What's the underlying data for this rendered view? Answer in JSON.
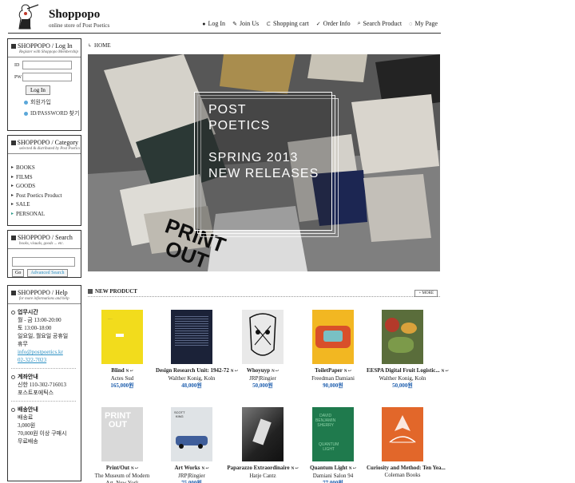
{
  "header": {
    "brand": "Shoppopo",
    "tagline": "online store of Post Poetics",
    "nav": [
      {
        "label": "Log In",
        "icon": "dot-icon",
        "glyph": "●"
      },
      {
        "label": "Join Us",
        "icon": "pen-icon",
        "glyph": "✎"
      },
      {
        "label": "Shopping cart",
        "icon": "cart-icon",
        "glyph": "⊂"
      },
      {
        "label": "Order Info",
        "icon": "check-icon",
        "glyph": "✓"
      },
      {
        "label": "Search Product",
        "icon": "search-icon",
        "glyph": "⌕"
      },
      {
        "label": "My Page",
        "icon": "circle-icon",
        "glyph": "◌"
      }
    ]
  },
  "login": {
    "title": "SHOPPOPO / Log In",
    "subtitle": "Register with Shoppopo Membership",
    "id_label": "ID",
    "pw_label": "PW",
    "button": "Log In",
    "links": [
      "회원가입",
      "ID/PASSWORD 찾기"
    ]
  },
  "category": {
    "title": "SHOPPOPO / Category",
    "subtitle": "selected & distributed by Post Poetics",
    "items": [
      "BOOKS",
      "FILMS",
      "GOODS",
      "Post Poetics Product",
      "SALE",
      "PERSONAL"
    ]
  },
  "search": {
    "title": "SHOPPOPO / Search",
    "subtitle": "books, visuals, goods ... etc.",
    "go": "Go",
    "advanced": "Advanced Search"
  },
  "help": {
    "title": "SHOPPOPO / Help",
    "subtitle": "for more informations and help",
    "sections": [
      {
        "head": "업무시간",
        "lines": [
          "월 - 금 13:00-20:00",
          "토 13:00-18:00",
          "일요일, 월요일 공휴일",
          "휴무"
        ],
        "extra": [
          "info@postpoetics.kr",
          "02-322-7023"
        ]
      },
      {
        "head": "계좌안내",
        "lines": [
          "신한 110-302-716013",
          "포스트포에틱스"
        ],
        "extra": []
      },
      {
        "head": "배송안내",
        "lines": [
          "배송료",
          "3,000원",
          "70,000원 이상 구매시",
          "무료배송"
        ],
        "extra": []
      }
    ]
  },
  "main": {
    "breadcrumb": "HOME",
    "hero": {
      "line1": "POST",
      "line2": "POETICS",
      "line3": "SPRING 2013",
      "line4": "NEW RELEASES"
    },
    "new_product_title": "NEW PRODUCT",
    "more": "+ MORE",
    "products": [
      {
        "name": "Blind",
        "badge": "N ↩",
        "author": "Actes Sud",
        "price": "165,000원",
        "cover": "#f2dc1c"
      },
      {
        "name": "Design Research Unit: 1942-72",
        "badge": "N ↩",
        "author": "Walther Konig, Koln",
        "price": "48,000원",
        "cover": "#1b2238"
      },
      {
        "name": "Whoyuyp",
        "badge": "N ↩",
        "author": "JRP|Ringier",
        "price": "50,000원",
        "cover": "#e9e9e9"
      },
      {
        "name": "ToiletPaper",
        "badge": "N ↩",
        "author": "Freedman Damiani",
        "price": "90,000원",
        "cover": "#f2b722"
      },
      {
        "name": "EESPA Digital Fruit Logistic...",
        "badge": "N ↩",
        "author": "Walther Konig, Koln",
        "price": "50,000원",
        "cover": "#5a6d3b"
      },
      {
        "name": "Print/Out",
        "badge": "N ↩",
        "author": "The Museum of Modern",
        "author2": "Art, New York",
        "price": "",
        "cover": "#d9d9d9"
      },
      {
        "name": "Art Works",
        "badge": "N ↩",
        "author": "JRP|Ringier",
        "price": "75,000원",
        "cover": "#dfe3e6"
      },
      {
        "name": "Paparazzo Extraordinaire",
        "badge": "N ↩",
        "author": "Hatje Cantz",
        "price": "",
        "cover": "#444444"
      },
      {
        "name": "Quantum Light",
        "badge": "N ↩",
        "author": "Damiani Salon 94",
        "price": "77,000원",
        "cover": "#1f7a4d"
      },
      {
        "name": "Curiosity and Method: Ten Yea...",
        "badge": "",
        "author": "Coleman Books",
        "price": "",
        "cover": "#e2672a"
      }
    ]
  }
}
